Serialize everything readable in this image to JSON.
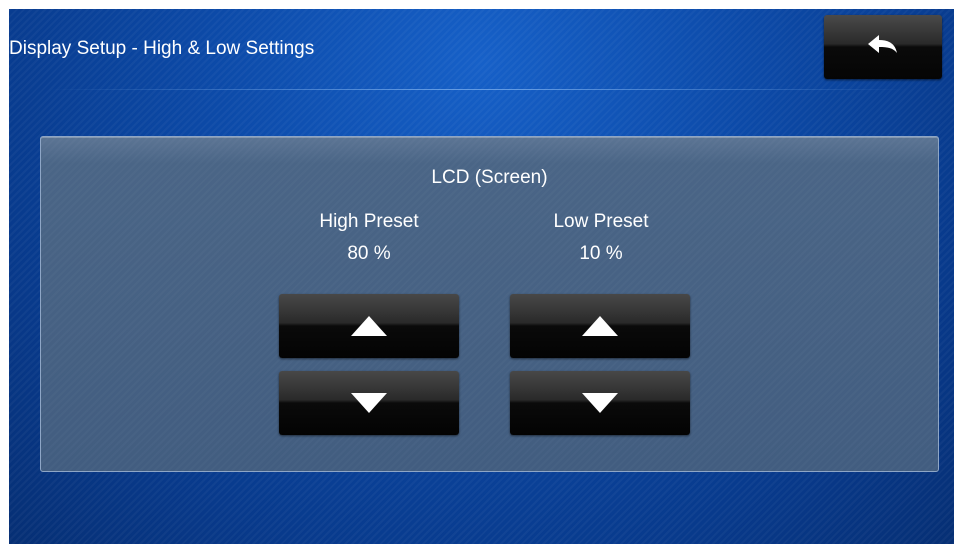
{
  "header": {
    "title": "Display Setup - High & Low Settings",
    "back_icon": "back-arrow-icon"
  },
  "panel": {
    "title": "LCD (Screen)",
    "high_preset": {
      "label": "High Preset",
      "value": "80 %"
    },
    "low_preset": {
      "label": "Low Preset",
      "value": "10 %"
    },
    "icons": {
      "increase": "up-triangle-icon",
      "decrease": "down-triangle-icon"
    }
  },
  "colors": {
    "background": "#0c4aa8",
    "panel": "#4a6586",
    "button": "#0a0a0a",
    "text": "#ffffff"
  }
}
